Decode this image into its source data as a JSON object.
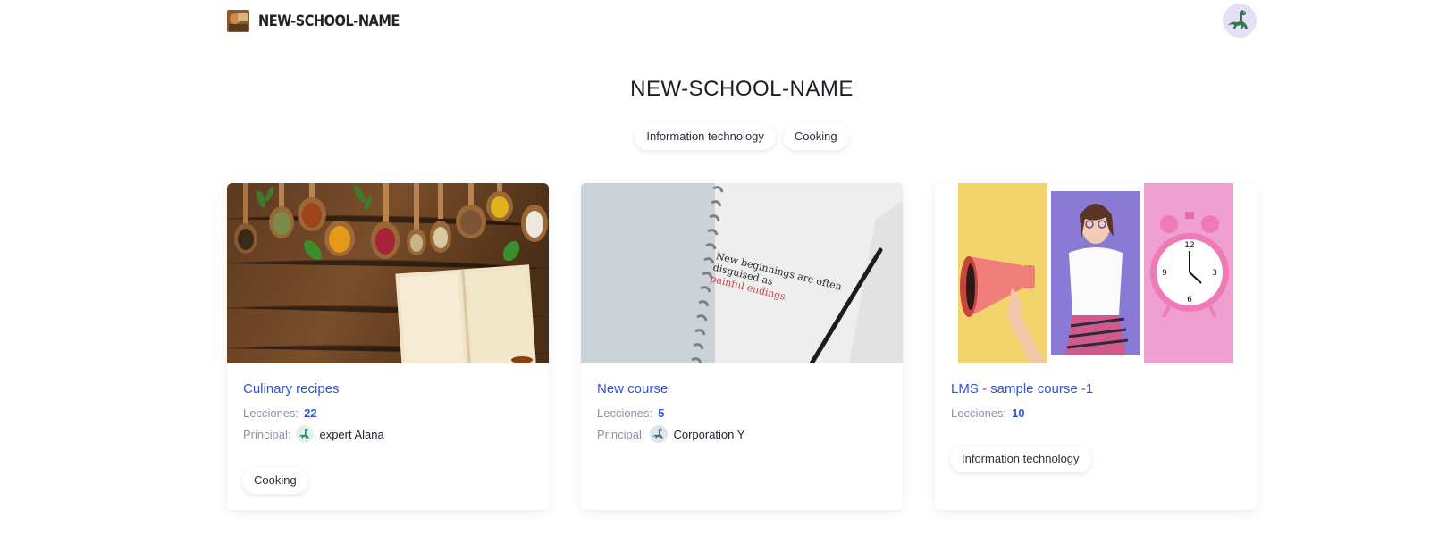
{
  "header": {
    "brand_name": "NEW-SCHOOL-NAME",
    "logo_icon": "school-logo-image",
    "avatar_icon": "dinosaur-icon"
  },
  "main": {
    "title": "NEW-SCHOOL-NAME",
    "categories": [
      "Information technology",
      "Cooking"
    ]
  },
  "courses": [
    {
      "title": "Culinary recipes",
      "lessons_label": "Lecciones:",
      "lessons": "22",
      "principal_label": "Principal:",
      "principal": "expert Alana",
      "category": "Cooking",
      "image": "spices-and-notebook-photo"
    },
    {
      "title": "New course",
      "lessons_label": "Lecciones:",
      "lessons": "5",
      "principal_label": "Principal:",
      "principal": "Corporation Y",
      "image": "notebook-quote-photo",
      "image_text": [
        "New beginnings are often",
        "disguised as",
        "painful endings."
      ]
    },
    {
      "title": "LMS - sample course -1",
      "lessons_label": "Lecciones:",
      "lessons": "10",
      "category": "Information technology",
      "image": "megaphone-woman-clock-collage"
    }
  ],
  "colors": {
    "accent": "#2f54d8",
    "muted": "#8c93a3",
    "avatar_bg": "#e4e0f5"
  }
}
